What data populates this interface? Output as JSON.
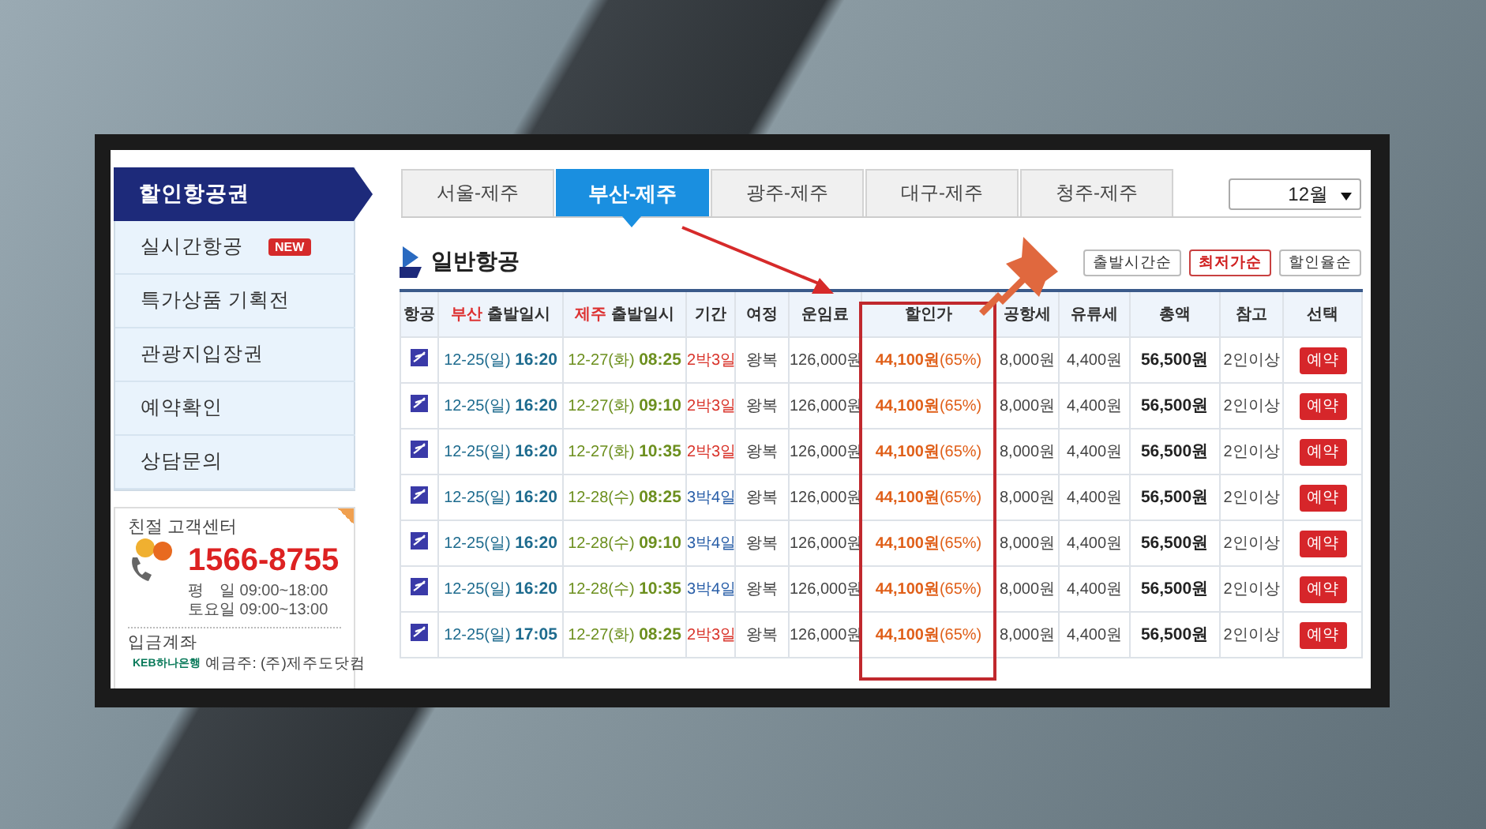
{
  "sidebar": {
    "menu": [
      {
        "label": "할인항공권",
        "selected": true
      },
      {
        "label": "실시간항공",
        "selected": false,
        "badge": "NEW"
      },
      {
        "label": "특가상품 기획전",
        "selected": false
      },
      {
        "label": "관광지입장권",
        "selected": false
      },
      {
        "label": "예약확인",
        "selected": false
      },
      {
        "label": "상담문의",
        "selected": false
      }
    ],
    "support": {
      "title": "친절 고객센터",
      "phone": "1566-8755",
      "hours": [
        "평　일 09:00~18:00",
        "토요일 09:00~13:00"
      ],
      "account_label": "입금계좌",
      "bank": "KEB하나은행",
      "holder": "예금주: (주)제주도닷컴"
    }
  },
  "tabs": [
    {
      "label": "서울-제주",
      "selected": false
    },
    {
      "label": "부산-제주",
      "selected": true
    },
    {
      "label": "광주-제주",
      "selected": false
    },
    {
      "label": "대구-제주",
      "selected": false
    },
    {
      "label": "청주-제주",
      "selected": false
    }
  ],
  "month_select": {
    "value": "12월"
  },
  "section": {
    "title": "일반항공"
  },
  "sort_buttons": [
    {
      "label": "출발시간순",
      "selected": false
    },
    {
      "label": "최저가순",
      "selected": true
    },
    {
      "label": "할인율순",
      "selected": false
    }
  ],
  "table": {
    "columns": [
      {
        "label": "항공"
      },
      {
        "city": "부산",
        "label": "출발일시"
      },
      {
        "city": "제주",
        "label": "출발일시"
      },
      {
        "label": "기간"
      },
      {
        "label": "여정"
      },
      {
        "label": "운임료"
      },
      {
        "label": "할인가"
      },
      {
        "label": "공항세"
      },
      {
        "label": "유류세"
      },
      {
        "label": "총액"
      },
      {
        "label": "참고"
      },
      {
        "label": "선택"
      }
    ],
    "rows": [
      {
        "dep_date": "12-25(일)",
        "dep_time": "16:20",
        "ret_date": "12-27(화)",
        "ret_time": "08:25",
        "duration": {
          "text": "2박3일",
          "color": "#d9342b"
        },
        "trip": "왕복",
        "fare": "126,000원",
        "discount": "**44,100원**(65%)",
        "airport_tax": "8,000원",
        "fuel_tax": "4,400원",
        "total": "56,500원",
        "note": "2인이상",
        "action": "예약"
      },
      {
        "dep_date": "12-25(일)",
        "dep_time": "16:20",
        "ret_date": "12-27(화)",
        "ret_time": "09:10",
        "duration": {
          "text": "2박3일",
          "color": "#d9342b"
        },
        "trip": "왕복",
        "fare": "126,000원",
        "discount": "**44,100원**(65%)",
        "airport_tax": "8,000원",
        "fuel_tax": "4,400원",
        "total": "56,500원",
        "note": "2인이상",
        "action": "예약"
      },
      {
        "dep_date": "12-25(일)",
        "dep_time": "16:20",
        "ret_date": "12-27(화)",
        "ret_time": "10:35",
        "duration": {
          "text": "2박3일",
          "color": "#d9342b"
        },
        "trip": "왕복",
        "fare": "126,000원",
        "discount": "**44,100원**(65%)",
        "airport_tax": "8,000원",
        "fuel_tax": "4,400원",
        "total": "56,500원",
        "note": "2인이상",
        "action": "예약"
      },
      {
        "dep_date": "12-25(일)",
        "dep_time": "16:20",
        "ret_date": "12-28(수)",
        "ret_time": "08:25",
        "duration": {
          "text": "3박4일",
          "color": "#2a5fa8"
        },
        "trip": "왕복",
        "fare": "126,000원",
        "discount": "**44,100원**(65%)",
        "airport_tax": "8,000원",
        "fuel_tax": "4,400원",
        "total": "56,500원",
        "note": "2인이상",
        "action": "예약"
      },
      {
        "dep_date": "12-25(일)",
        "dep_time": "16:20",
        "ret_date": "12-28(수)",
        "ret_time": "09:10",
        "duration": {
          "text": "3박4일",
          "color": "#2a5fa8"
        },
        "trip": "왕복",
        "fare": "126,000원",
        "discount": "**44,100원**(65%)",
        "airport_tax": "8,000원",
        "fuel_tax": "4,400원",
        "total": "56,500원",
        "note": "2인이상",
        "action": "예약"
      },
      {
        "dep_date": "12-25(일)",
        "dep_time": "16:20",
        "ret_date": "12-28(수)",
        "ret_time": "10:35",
        "duration": {
          "text": "3박4일",
          "color": "#2a5fa8"
        },
        "trip": "왕복",
        "fare": "126,000원",
        "discount": "**44,100원**(65%)",
        "airport_tax": "8,000원",
        "fuel_tax": "4,400원",
        "total": "56,500원",
        "note": "2인이상",
        "action": "예약"
      },
      {
        "dep_date": "12-25(일)",
        "dep_time": "17:05",
        "ret_date": "12-27(화)",
        "ret_time": "08:25",
        "duration": {
          "text": "2박3일",
          "color": "#d9342b"
        },
        "trip": "왕복",
        "fare": "126,000원",
        "discount": "**44,100원**(65%)",
        "airport_tax": "8,000원",
        "fuel_tax": "4,400원",
        "total": "56,500원",
        "note": "2인이상",
        "action": "예약"
      }
    ]
  }
}
